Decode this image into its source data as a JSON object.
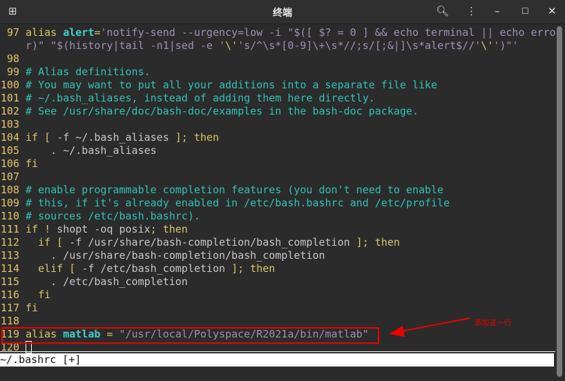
{
  "window": {
    "title": "终端"
  },
  "colors": {
    "ln": "#e5c56a",
    "kw": "#d8c76a",
    "id": "#3fd0d0",
    "str": "#a08fb8",
    "cm": "#2ec4b6",
    "txt": "#c8c8c8",
    "annot": "#ee0000"
  },
  "lines": [
    {
      "n": "97",
      "s": [
        {
          "t": "alias ",
          "c": "kw"
        },
        {
          "t": "alert",
          "c": "idb"
        },
        {
          "t": "=",
          "c": "kw"
        },
        {
          "t": "'notify-send --urgency=low -i \"$([ $? = 0 ] && echo terminal || echo erro",
          "c": "str"
        }
      ]
    },
    {
      "n": "",
      "s": [
        {
          "t": "r)\" \"$(history|tail -n1|sed -e '",
          "c": "str"
        },
        {
          "t": "\\'",
          "c": "kw"
        },
        {
          "t": "'s/^\\s*[0-9]\\+\\s*//;s/[;&|]\\s*alert$//'",
          "c": "str"
        },
        {
          "t": "\\'",
          "c": "kw"
        },
        {
          "t": "')\"'",
          "c": "str"
        }
      ]
    },
    {
      "n": "98",
      "s": []
    },
    {
      "n": "99",
      "s": [
        {
          "t": "# Alias definitions.",
          "c": "cm"
        }
      ]
    },
    {
      "n": "100",
      "s": [
        {
          "t": "# You may want to put all your additions into a separate file like",
          "c": "cm"
        }
      ]
    },
    {
      "n": "101",
      "s": [
        {
          "t": "# ~/.bash_aliases, instead of adding them here directly.",
          "c": "cm"
        }
      ]
    },
    {
      "n": "102",
      "s": [
        {
          "t": "# See /usr/share/doc/bash-doc/examples in the bash-doc package.",
          "c": "cm"
        }
      ]
    },
    {
      "n": "103",
      "s": []
    },
    {
      "n": "104",
      "s": [
        {
          "t": "if ",
          "c": "kw"
        },
        {
          "t": "[ ",
          "c": "kw"
        },
        {
          "t": "-f ~/.bash_aliases ",
          "c": "txt"
        },
        {
          "t": "]; then",
          "c": "kw"
        }
      ]
    },
    {
      "n": "105",
      "s": [
        {
          "t": "    . ~/.bash_aliases",
          "c": "txt"
        }
      ]
    },
    {
      "n": "106",
      "s": [
        {
          "t": "fi",
          "c": "kw"
        }
      ]
    },
    {
      "n": "107",
      "s": []
    },
    {
      "n": "108",
      "s": [
        {
          "t": "# enable programmable completion features (you don't need to enable",
          "c": "cm"
        }
      ]
    },
    {
      "n": "109",
      "s": [
        {
          "t": "# this, if it's already enabled in /etc/bash.bashrc and /etc/profile",
          "c": "cm"
        }
      ]
    },
    {
      "n": "110",
      "s": [
        {
          "t": "# sources /etc/bash.bashrc).",
          "c": "cm"
        }
      ]
    },
    {
      "n": "111",
      "s": [
        {
          "t": "if ! ",
          "c": "kw"
        },
        {
          "t": "shopt -oq posix",
          "c": "txt"
        },
        {
          "t": "; then",
          "c": "kw"
        }
      ]
    },
    {
      "n": "112",
      "s": [
        {
          "t": "  if [ ",
          "c": "kw"
        },
        {
          "t": "-f /usr/share/bash-completion/bash_completion ",
          "c": "txt"
        },
        {
          "t": "]; then",
          "c": "kw"
        }
      ]
    },
    {
      "n": "113",
      "s": [
        {
          "t": "    . /usr/share/bash-completion/bash_completion",
          "c": "txt"
        }
      ]
    },
    {
      "n": "114",
      "s": [
        {
          "t": "  elif [ ",
          "c": "kw"
        },
        {
          "t": "-f /etc/bash_completion ",
          "c": "txt"
        },
        {
          "t": "]; then",
          "c": "kw"
        }
      ]
    },
    {
      "n": "115",
      "s": [
        {
          "t": "    . /etc/bash_completion",
          "c": "txt"
        }
      ]
    },
    {
      "n": "116",
      "s": [
        {
          "t": "  fi",
          "c": "kw"
        }
      ]
    },
    {
      "n": "117",
      "s": [
        {
          "t": "fi",
          "c": "kw"
        }
      ]
    },
    {
      "n": "118",
      "s": []
    },
    {
      "n": "119",
      "s": [
        {
          "t": "alias ",
          "c": "kw"
        },
        {
          "t": "matlab",
          "c": "idb"
        },
        {
          "t": " = ",
          "c": "kw"
        },
        {
          "t": "\"/usr/local/Polyspace/R2021a/bin/matlab\"",
          "c": "str"
        }
      ]
    },
    {
      "n": "120",
      "s": []
    }
  ],
  "status": {
    "text": "~/.bashrc [+]"
  },
  "annotation": {
    "text": "添加这一行"
  }
}
